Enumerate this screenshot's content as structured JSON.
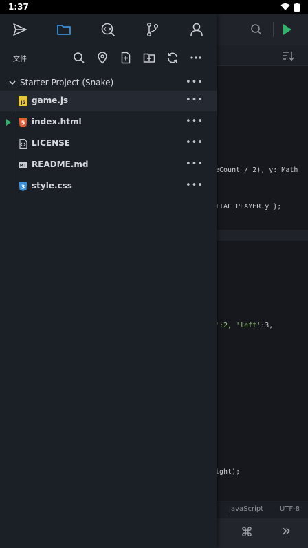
{
  "status_bar": {
    "time": "1:37"
  },
  "drawer": {
    "nav_icons": [
      "send-icon",
      "folder-icon",
      "code-search-icon",
      "git-branch-icon",
      "user-icon"
    ],
    "file_panel_title": "文件",
    "toolbar_icons": [
      "search-icon",
      "location-pin-icon",
      "new-file-icon",
      "new-folder-icon",
      "refresh-icon",
      "more-icon"
    ],
    "project": {
      "name": "Starter Project (Snake)",
      "more": "•••"
    },
    "files": [
      {
        "name": "game.js",
        "type": "js",
        "icon_label": "JS",
        "more": "•••"
      },
      {
        "name": "index.html",
        "type": "html",
        "icon_label": "5",
        "more": "•••"
      },
      {
        "name": "LICENSE",
        "type": "license",
        "icon_label": "",
        "more": "•••"
      },
      {
        "name": "README.md",
        "type": "markdown",
        "icon_label": "M↓",
        "more": "•••"
      },
      {
        "name": "style.css",
        "type": "css",
        "icon_label": "3",
        "more": "•••"
      }
    ]
  },
  "editor": {
    "code_fragments": {
      "line1": "eCount / 2), y: Math",
      "line2": "TIAL_PLAYER.y };",
      "line3a": "':2, ",
      "line3b": "'left'",
      "line3c": ":3,",
      "line4": "ight);"
    },
    "status": {
      "language": "JavaScript",
      "encoding": "UTF-8"
    },
    "bottom_symbols": {
      "command": "⌘",
      "forward": "»"
    }
  },
  "colors": {
    "accent": "#3a8fd8",
    "run_green": "#2fb36b",
    "js_yellow": "#e8c63a",
    "html_orange": "#e05a33",
    "css_blue": "#3a8fd8"
  }
}
